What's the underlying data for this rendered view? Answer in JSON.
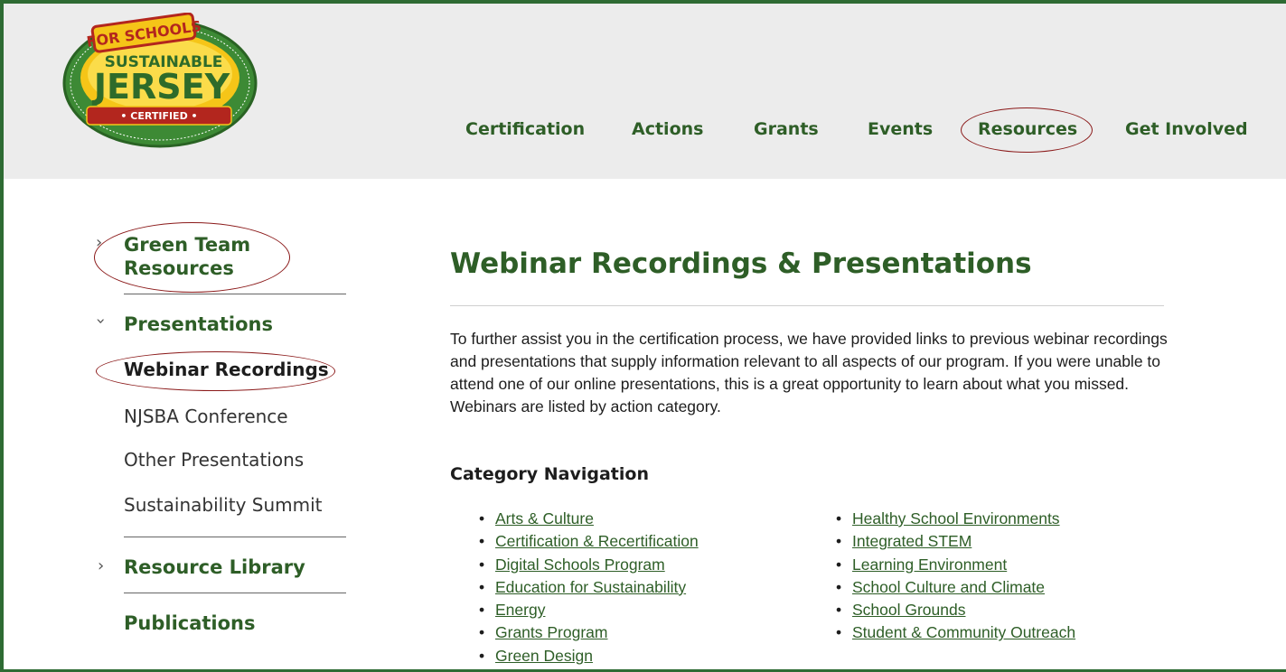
{
  "logo": {
    "top_text": "FOR SCHOOLS",
    "line1": "SUSTAINABLE",
    "line2": "JERSEY",
    "ribbon": "• CERTIFIED •"
  },
  "nav": {
    "items": [
      "Certification",
      "Actions",
      "Grants",
      "Events",
      "Resources",
      "Get Involved"
    ]
  },
  "sidebar": {
    "green_team": "Green Team Resources",
    "presentations": "Presentations",
    "subitems": [
      "Webinar Recordings",
      "NJSBA Conference",
      "Other Presentations",
      "Sustainability Summit"
    ],
    "resource_library": "Resource Library",
    "publications": "Publications"
  },
  "main": {
    "title": "Webinar Recordings & Presentations",
    "intro": "To further assist you in the certification process, we have provided links to previous webinar recordings and presentations that supply information relevant to all aspects of our program. If you were unable to attend one of our online presentations, this is a great opportunity to learn about what you missed. Webinars are listed by action category.",
    "category_heading": "Category Navigation",
    "categories_left": [
      "Arts & Culture",
      "Certification & Recertification",
      "Digital Schools Program",
      "Education for Sustainability",
      "Energy",
      "Grants Program",
      "Green Design"
    ],
    "categories_right": [
      "Healthy School Environments",
      "Integrated STEM",
      "Learning Environment",
      "School Culture and Climate",
      "School Grounds",
      "Student & Community Outreach"
    ]
  },
  "colors": {
    "brand_green": "#2e5e27",
    "annotation_red": "#8b1a1a",
    "header_bg": "#ececec"
  }
}
